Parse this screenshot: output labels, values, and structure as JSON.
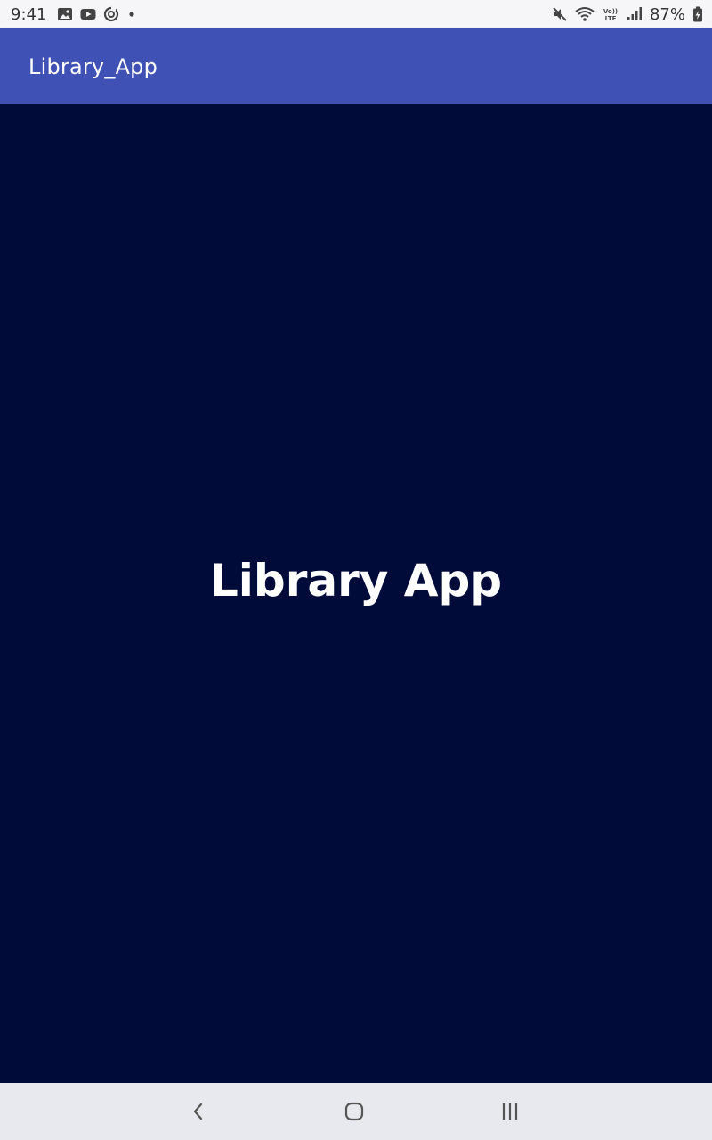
{
  "status_bar": {
    "time": "9:41",
    "battery_percent": "87%",
    "left_icons": [
      "gallery-icon",
      "youtube-icon",
      "sync-icon",
      "notification-dot-icon"
    ],
    "right_icons": [
      "mute-icon",
      "wifi-icon",
      "volte-lte-icon",
      "signal-icon",
      "battery-charging-icon"
    ]
  },
  "app_bar": {
    "title": "Library_App",
    "color": "#3F51B5"
  },
  "main": {
    "title": "Library App",
    "background": "#000B3A"
  },
  "nav_bar": {
    "buttons": [
      "back-icon",
      "home-icon",
      "recents-icon"
    ]
  }
}
